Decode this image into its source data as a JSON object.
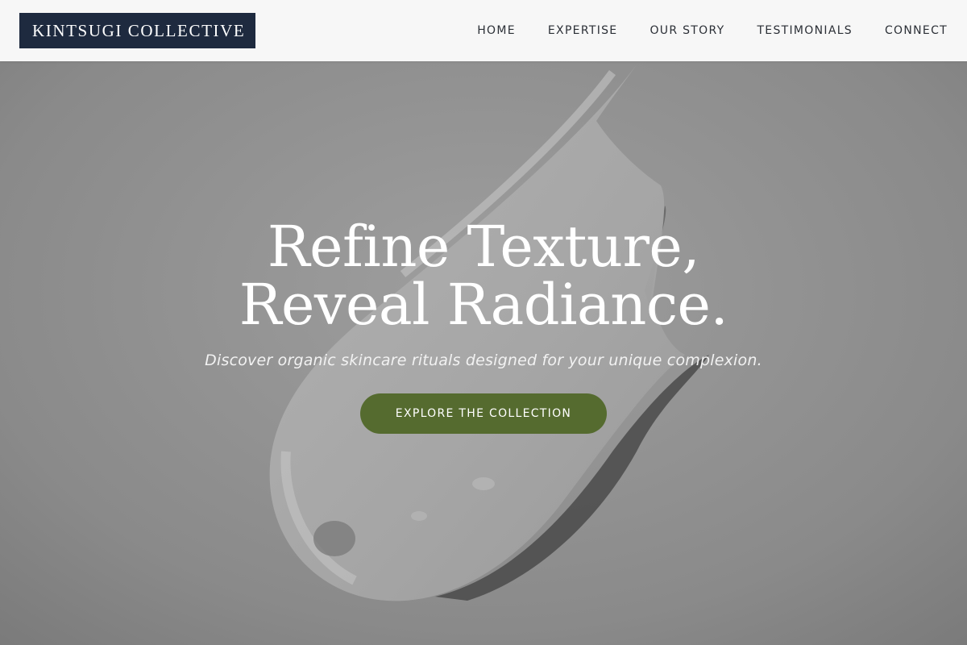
{
  "brand": {
    "logo_text": "KINTSUGI COLLECTIVE"
  },
  "nav": {
    "items": [
      {
        "label": "HOME"
      },
      {
        "label": "EXPERTISE"
      },
      {
        "label": "OUR STORY"
      },
      {
        "label": "TESTIMONIALS"
      },
      {
        "label": "CONNECT"
      }
    ]
  },
  "hero": {
    "title": "Refine Texture, Reveal Radiance.",
    "subtitle": "Discover organic skincare rituals designed for your unique complexion.",
    "cta_label": "EXPLORE THE COLLECTION"
  },
  "colors": {
    "logo_bg": "#1e2a3f",
    "header_bg": "#f7f7f7",
    "cta_bg": "#556b2f",
    "hero_bg": "#8c8c8c"
  }
}
